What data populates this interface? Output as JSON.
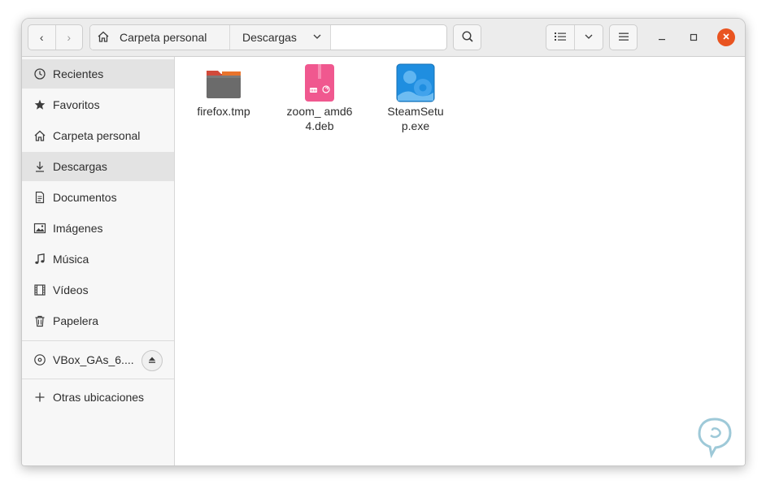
{
  "header": {
    "back_glyph": "‹",
    "forward_glyph": "›",
    "breadcrumb": [
      {
        "label": "Carpeta personal"
      },
      {
        "label": "Descargas"
      }
    ]
  },
  "sidebar": {
    "items": [
      {
        "label": "Recientes",
        "icon": "clock-icon"
      },
      {
        "label": "Favoritos",
        "icon": "star-icon"
      },
      {
        "label": "Carpeta personal",
        "icon": "home-icon"
      },
      {
        "label": "Descargas",
        "icon": "download-icon"
      },
      {
        "label": "Documentos",
        "icon": "document-icon"
      },
      {
        "label": "Imágenes",
        "icon": "image-icon"
      },
      {
        "label": "Música",
        "icon": "music-icon"
      },
      {
        "label": "Vídeos",
        "icon": "video-icon"
      },
      {
        "label": "Papelera",
        "icon": "trash-icon"
      }
    ],
    "device": {
      "label": "VBox_GAs_6....",
      "icon": "disc-icon"
    },
    "other": {
      "label": "Otras ubicaciones",
      "icon": "plus-icon"
    }
  },
  "files": [
    {
      "name": "firefox.tmp",
      "icon": "folder-icon"
    },
    {
      "name": "zoom_ amd64.deb",
      "icon": "deb-package-icon"
    },
    {
      "name": "SteamSetu p.exe",
      "icon": "exe-icon"
    }
  ],
  "colors": {
    "accent_close": "#e95420",
    "deb_pink": "#f0588f",
    "exe_blue": "#1f8ee0",
    "folder_grey": "#6b6b6b"
  }
}
